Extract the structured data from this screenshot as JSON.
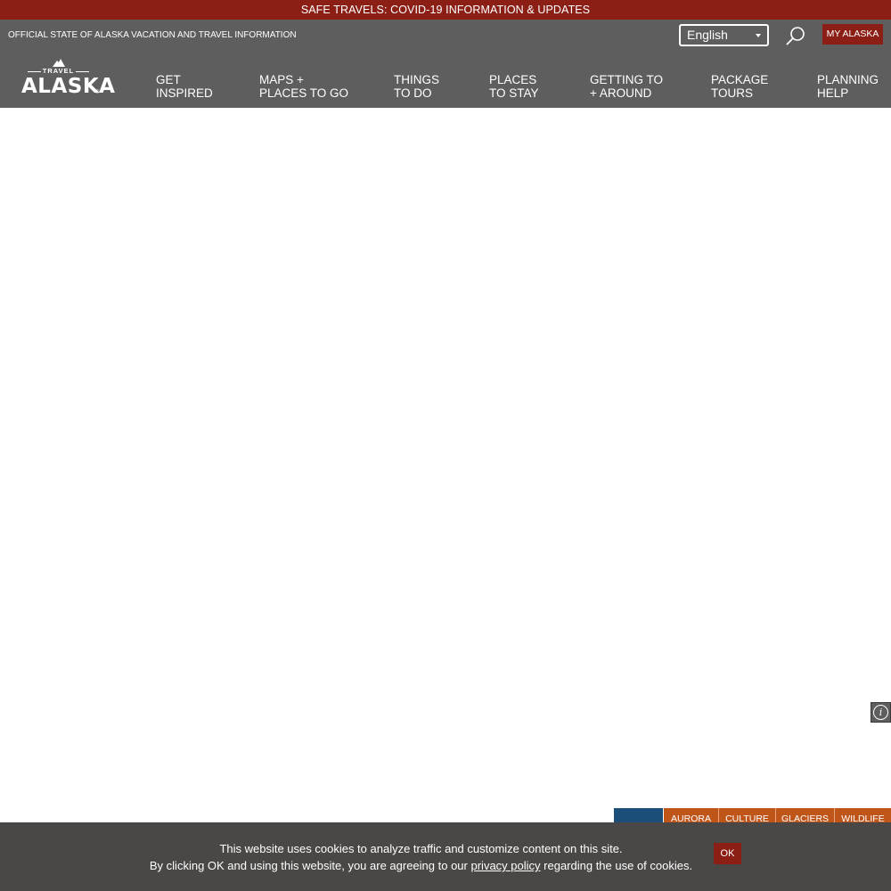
{
  "alert": {
    "text": "SAFE TRAVELS: COVID-19 INFORMATION & UPDATES"
  },
  "header": {
    "official_text": "OFFICIAL STATE OF ALASKA VACATION AND TRAVEL INFORMATION",
    "language": {
      "selected": "English"
    },
    "search_icon": "search-icon",
    "my_alaska_label": "MY ALASKA"
  },
  "logo": {
    "travel": "TRAVEL",
    "wordmark": "ALASKA",
    "reg": "®"
  },
  "nav": [
    {
      "line1": "GET",
      "line2": "INSPIRED"
    },
    {
      "line1": "MAPS +",
      "line2": "PLACES TO GO"
    },
    {
      "line1": "THINGS",
      "line2": "TO DO"
    },
    {
      "line1": "PLACES",
      "line2": "TO STAY"
    },
    {
      "line1": "GETTING TO",
      "line2": "+ AROUND"
    },
    {
      "line1": "PACKAGE",
      "line2": "TOURS"
    },
    {
      "line1": "PLANNING",
      "line2": "HELP"
    }
  ],
  "info_button": {
    "icon": "info-icon",
    "glyph": "i"
  },
  "topic_tabs": [
    "AURORA",
    "CULTURE",
    "GLACIERS",
    "WILDLIFE"
  ],
  "cookie": {
    "line1": "This website uses cookies to analyze traffic and customize content on this site.",
    "line2_before": "By clicking OK and using this website, you are agreeing to our",
    "link": "privacy policy",
    "line2_after": "regarding the use of cookies.",
    "ok_label": "OK"
  },
  "colors": {
    "brand_red": "#8b1f16",
    "header_gray": "#5e5e5e",
    "tab_orange": "#c0551a",
    "tab_blue": "#1c4e7a",
    "cookie_bg": "#4a4846"
  }
}
